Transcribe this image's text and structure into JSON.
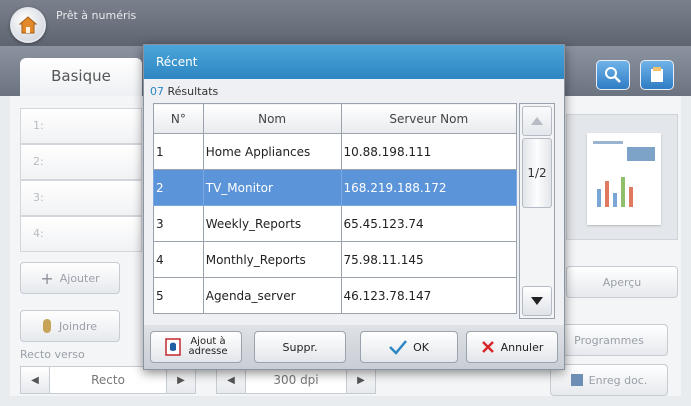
{
  "app": {
    "title": "Prêt à numéris"
  },
  "tabs": {
    "active": "Basique"
  },
  "address_rows": [
    "1:",
    "2:",
    "3:",
    "4:"
  ],
  "buttons": {
    "add": "Ajouter",
    "attach": "Joindre",
    "preview": "Aperçu",
    "programs": "Programmes",
    "save_doc": "Enreg doc."
  },
  "settings": {
    "duplex_label": "Recto verso",
    "duplex_value": "Recto",
    "resolution_value": "300 dpi"
  },
  "dialog": {
    "title": "Récent",
    "results_count": "07",
    "results_label": " Résultats",
    "columns": [
      "N°",
      "Nom",
      "Serveur Nom"
    ],
    "rows": [
      {
        "no": "1",
        "name": "Home Appliances",
        "server": "10.88.198.111",
        "selected": false
      },
      {
        "no": "2",
        "name": "TV_Monitor",
        "server": "168.219.188.172",
        "selected": true
      },
      {
        "no": "3",
        "name": "Weekly_Reports",
        "server": "65.45.123.74",
        "selected": false
      },
      {
        "no": "4",
        "name": "Monthly_Reports",
        "server": "75.98.11.145",
        "selected": false
      },
      {
        "no": "5",
        "name": "Agenda_server",
        "server": "46.123.78.147",
        "selected": false
      }
    ],
    "page_indicator": "1/2",
    "footer": {
      "add_address_line1": "Ajout à",
      "add_address_line2": "adresse",
      "delete": "Suppr.",
      "ok": "OK",
      "cancel": "Annuler"
    }
  },
  "colors": {
    "header_blue": "#2e86c2",
    "selected_row": "#5b94d9",
    "ok_check": "#2e86c2",
    "cancel_x": "#d8262b"
  }
}
